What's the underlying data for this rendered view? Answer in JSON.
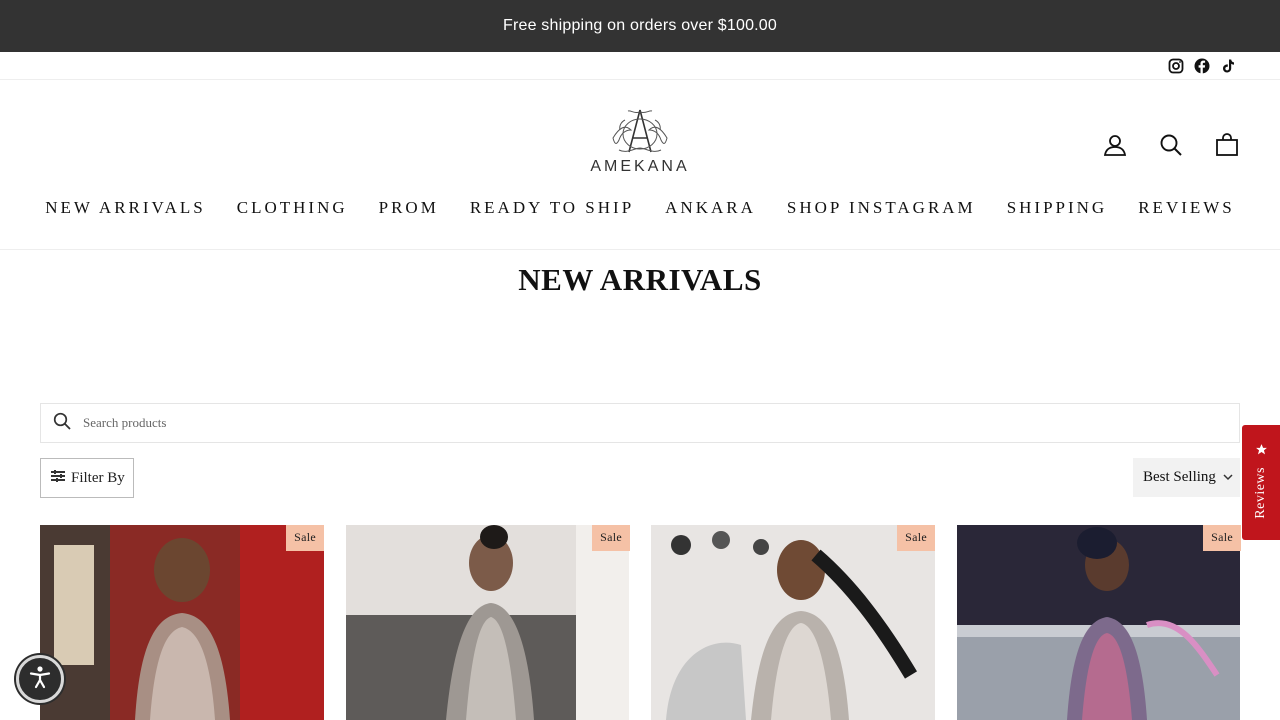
{
  "announcement": {
    "text": "Free shipping on orders over $100.00"
  },
  "social": [
    {
      "name": "instagram-icon"
    },
    {
      "name": "facebook-icon"
    },
    {
      "name": "tiktok-icon"
    }
  ],
  "logo": {
    "text": "AMEKANA"
  },
  "nav": {
    "items": [
      "NEW ARRIVALS",
      "CLOTHING",
      "PROM",
      "READY TO SHIP",
      "ANKARA",
      "SHOP INSTAGRAM",
      "SHIPPING",
      "REVIEWS"
    ]
  },
  "page": {
    "title": "NEW ARRIVALS"
  },
  "search": {
    "placeholder": "Search products",
    "value": ""
  },
  "filter": {
    "label": "Filter By"
  },
  "sort": {
    "selected": "Best Selling"
  },
  "reviews_tab": {
    "label": "Reviews"
  },
  "products": [
    {
      "badge": "Sale",
      "bg": "#8a2a25"
    },
    {
      "badge": "Sale",
      "bg": "#8f8a86"
    },
    {
      "badge": "Sale",
      "bg": "#d6d1cd"
    },
    {
      "badge": "Sale",
      "bg": "#2a2738"
    }
  ],
  "colors": {
    "announce_bg": "#333333",
    "sale_badge": "#f5c1a6",
    "reviews_tab": "#c0151c",
    "sort_bg": "#f2f2f2"
  }
}
